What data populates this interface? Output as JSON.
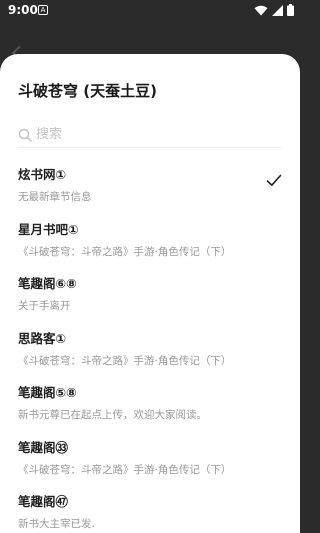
{
  "status_bar": {
    "time": "9:00",
    "notification_glyph": "A"
  },
  "sheet": {
    "title": "斗破苍穹 (天蚕土豆)",
    "search": {
      "placeholder": "搜索",
      "value": ""
    }
  },
  "sources": [
    {
      "name": "炫书网①",
      "latest": "无最新章节信息",
      "selected": true
    },
    {
      "name": "星月书吧①",
      "latest": "《斗破苍穹：斗帝之路》手游·角色传记（下）",
      "selected": false
    },
    {
      "name": "笔趣阁⑥⑧",
      "latest": "关于手离开",
      "selected": false
    },
    {
      "name": "思路客①",
      "latest": "《斗破苍穹：斗帝之路》手游·角色传记（下）",
      "selected": false
    },
    {
      "name": "笔趣阁⑤⑧",
      "latest": "新书元尊已在起点上传，欢迎大家阅读。",
      "selected": false
    },
    {
      "name": "笔趣阁㉝",
      "latest": "《斗破苍穹：斗帝之路》手游·角色传记（下）",
      "selected": false
    },
    {
      "name": "笔趣阁㊼",
      "latest": "新书大主宰已发.",
      "selected": false
    }
  ],
  "icons": {
    "wifi": "wifi-icon",
    "signal": "signal-icon",
    "battery": "battery-icon",
    "search": "search-icon",
    "check": "checkmark-icon"
  }
}
